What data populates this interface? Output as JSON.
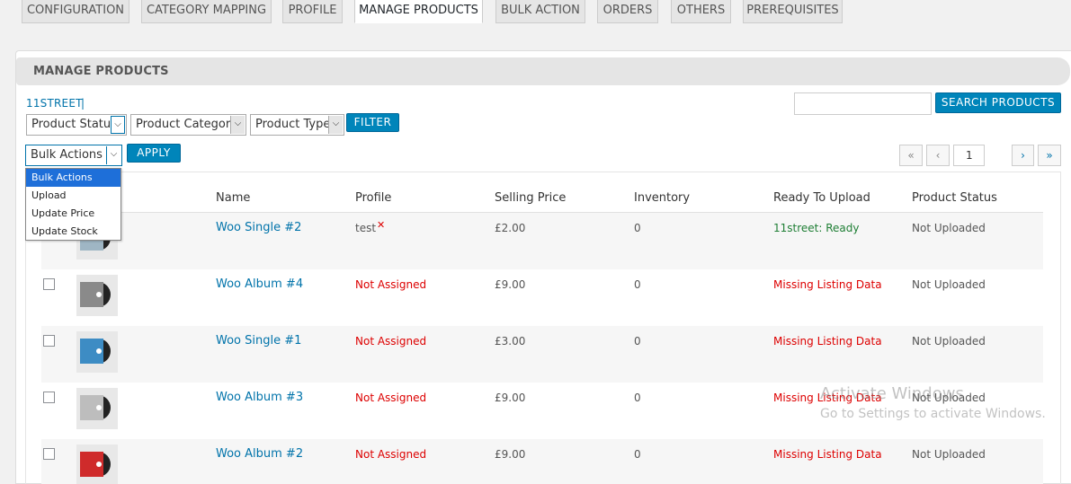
{
  "tabs": [
    {
      "label": "CONFIGURATION"
    },
    {
      "label": "CATEGORY MAPPING"
    },
    {
      "label": "PROFILE"
    },
    {
      "label": "MANAGE PRODUCTS"
    },
    {
      "label": "BULK ACTION"
    },
    {
      "label": "ORDERS"
    },
    {
      "label": "OTHERS"
    },
    {
      "label": "PREREQUISITES"
    }
  ],
  "panel": {
    "title": "MANAGE PRODUCTS",
    "marketplace_link": "11STREET",
    "separator": "|"
  },
  "search": {
    "value": "",
    "button": "SEARCH PRODUCTS"
  },
  "filters": {
    "status": "Product Status",
    "category": "Product Category",
    "type": "Product Type",
    "filter_button": "FILTER"
  },
  "bulk": {
    "selected": "Bulk Actions",
    "apply_button": "APPLY",
    "options": [
      "Bulk Actions",
      "Upload",
      "Update Price",
      "Update Stock"
    ]
  },
  "pagination": {
    "first": "«",
    "prev": "‹",
    "current_page": "1",
    "next": "›",
    "last": "»"
  },
  "table": {
    "headers": {
      "name": "Name",
      "profile": "Profile",
      "price": "Selling Price",
      "inventory": "Inventory",
      "ready": "Ready To Upload",
      "status": "Product Status"
    },
    "rows": [
      {
        "name": "Woo Single #2",
        "profile": "test",
        "price": "£2.00",
        "inventory": "0",
        "ready": "11street: Ready",
        "status": "Not Uploaded"
      },
      {
        "name": "Woo Album #4",
        "profile": "Not Assigned",
        "price": "£9.00",
        "inventory": "0",
        "ready": "Missing Listing Data",
        "status": "Not Uploaded"
      },
      {
        "name": "Woo Single #1",
        "profile": "Not Assigned",
        "price": "£3.00",
        "inventory": "0",
        "ready": "Missing Listing Data",
        "status": "Not Uploaded"
      },
      {
        "name": "Woo Album #3",
        "profile": "Not Assigned",
        "price": "£9.00",
        "inventory": "0",
        "ready": "Missing Listing Data",
        "status": "Not Uploaded"
      },
      {
        "name": "Woo Album #2",
        "profile": "Not Assigned",
        "price": "£9.00",
        "inventory": "0",
        "ready": "Missing Listing Data",
        "status": "Not Uploaded"
      }
    ]
  },
  "watermark": {
    "line1": "Activate Windows",
    "line2": "Go to Settings to activate Windows."
  },
  "colors": {
    "link": "#0073aa",
    "button": "#0085ba",
    "error": "#dd0000",
    "ready": "#1e7e34"
  },
  "icons": {
    "remove_profile": "close-icon",
    "dropdown": "chevron-down-icon",
    "thumbnail": "album-thumbnail"
  }
}
